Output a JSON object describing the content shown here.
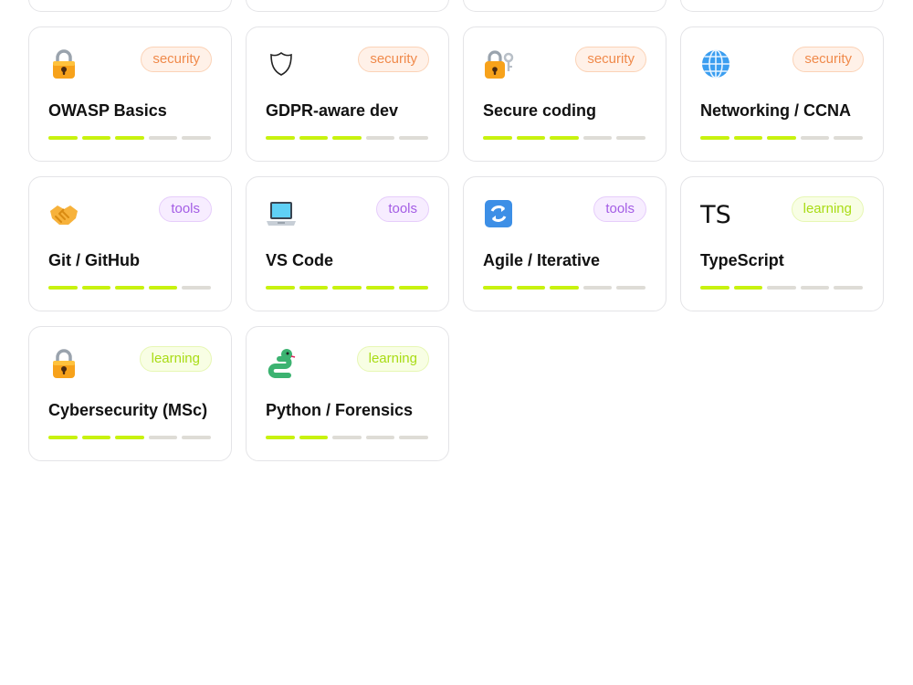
{
  "top_cards": [
    {},
    {},
    {},
    {}
  ],
  "skills": [
    {
      "icon": "padlock-icon",
      "badge": "security",
      "title": "OWASP Basics",
      "level": 3,
      "max": 5
    },
    {
      "icon": "shield-icon",
      "badge": "security",
      "title": "GDPR-aware dev",
      "level": 3,
      "max": 5
    },
    {
      "icon": "padlock-key-icon",
      "badge": "security",
      "title": "Secure coding",
      "level": 3,
      "max": 5
    },
    {
      "icon": "globe-icon",
      "badge": "security",
      "title": "Networking / CCNA",
      "level": 3,
      "max": 5
    },
    {
      "icon": "handshake-icon",
      "badge": "tools",
      "title": "Git / GitHub",
      "level": 4,
      "max": 5
    },
    {
      "icon": "laptop-icon",
      "badge": "tools",
      "title": "VS Code",
      "level": 5,
      "max": 5
    },
    {
      "icon": "refresh-icon",
      "badge": "tools",
      "title": "Agile / Iterative",
      "level": 3,
      "max": 5
    },
    {
      "icon": "ts-icon",
      "icon_text": "TS",
      "badge": "learning",
      "title": "TypeScript",
      "level": 2,
      "max": 5
    },
    {
      "icon": "padlock-icon",
      "badge": "learning",
      "title": "Cybersecurity (MSc)",
      "level": 3,
      "max": 5
    },
    {
      "icon": "snake-icon",
      "badge": "learning",
      "title": "Python / Forensics",
      "level": 2,
      "max": 5
    }
  ],
  "colors": {
    "bar_on": "#c8f20f",
    "bar_off": "#dedcd6",
    "security": "#f08a4b",
    "tools": "#a45de5",
    "learning": "#a9dc15"
  }
}
